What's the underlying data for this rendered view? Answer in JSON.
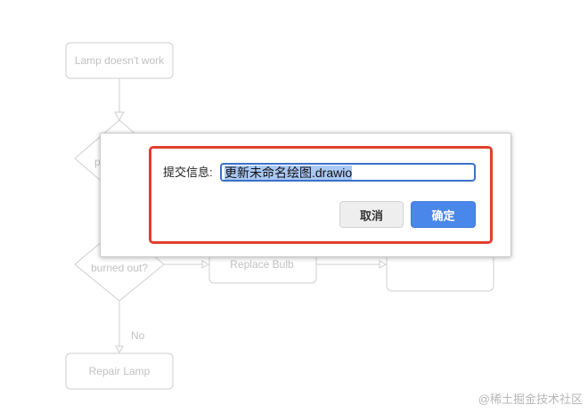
{
  "diagram": {
    "nodes": {
      "lamp_doesnt_work": "Lamp doesn't work",
      "plugged_in_partial": "p",
      "burned_out": "burned out?",
      "replace_bulb": "Replace Bulb",
      "repair_lamp": "Repair Lamp"
    },
    "edge_labels": {
      "no": "No"
    }
  },
  "dialog": {
    "field_label": "提交信息:",
    "filename_value": "更新未命名绘图.drawio",
    "cancel_label": "取消",
    "ok_label": "确定"
  },
  "watermark": "@稀土掘金技术社区",
  "colors": {
    "diagram_stroke": "#cfcfcf",
    "diagram_text": "#c2c2c2",
    "highlight_frame": "#e0402f",
    "primary_button": "#4a87ea",
    "input_border": "#3b71c9",
    "selection": "#a9c8f4"
  }
}
